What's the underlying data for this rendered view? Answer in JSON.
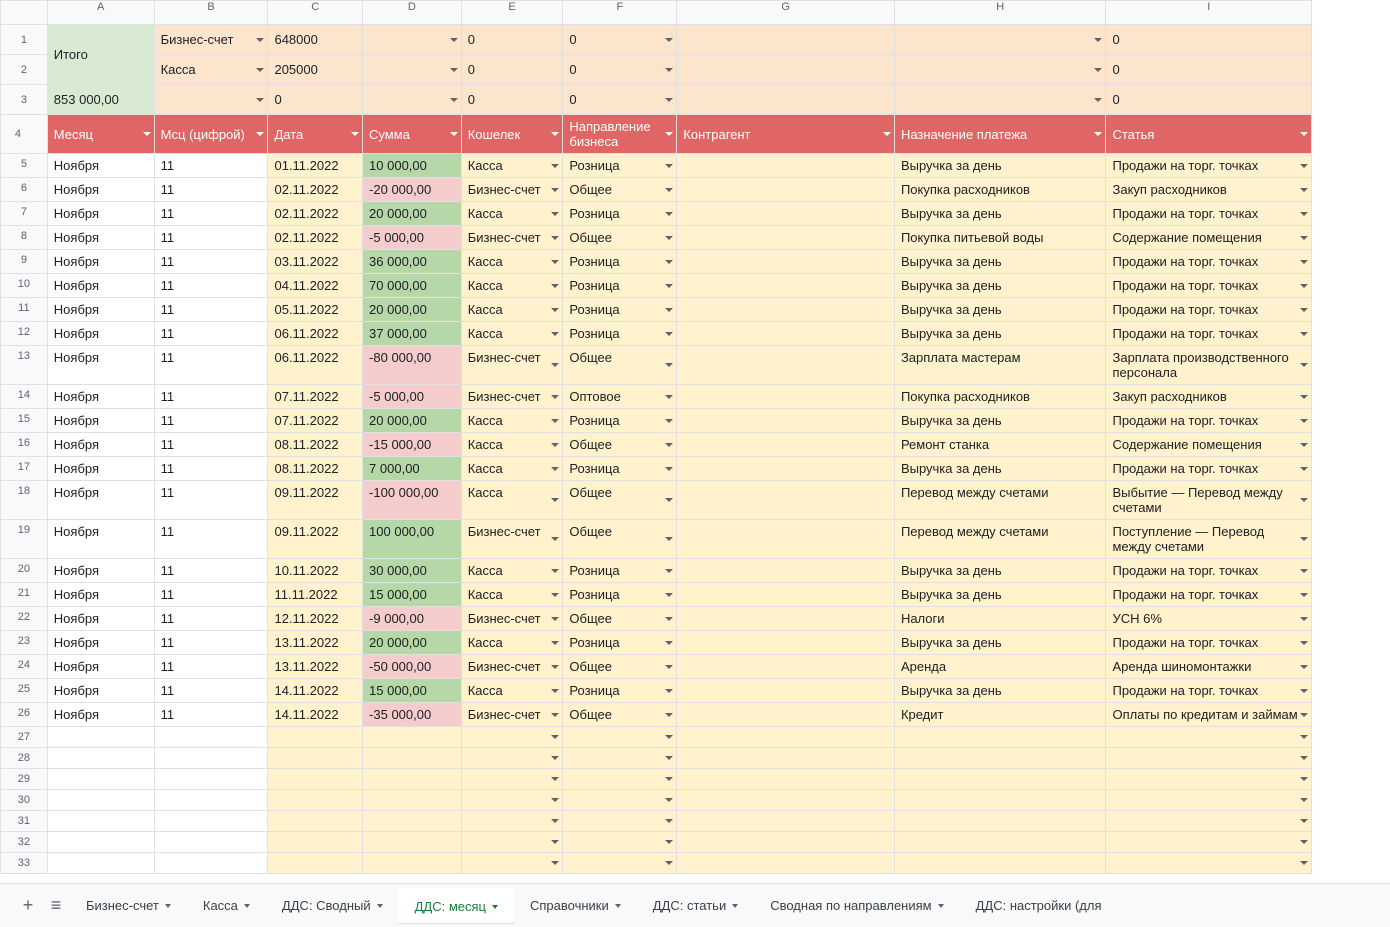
{
  "columns": [
    "A",
    "B",
    "C",
    "D",
    "E",
    "F",
    "G",
    "H",
    "I"
  ],
  "summary": {
    "itogo_label": "Итого",
    "row1": {
      "B": "Бизнес-счет",
      "C": "648000",
      "E": "0",
      "F": "0",
      "H": "",
      "I": "0"
    },
    "row2": {
      "B": "Касса",
      "C": "205000",
      "E": "0",
      "F": "0",
      "H": "",
      "I": "0"
    },
    "row3": {
      "A": "853 000,00",
      "B": "",
      "C": "0",
      "E": "0",
      "F": "0",
      "H": "",
      "I": "0"
    }
  },
  "headers": {
    "A": "Месяц",
    "B": "Мсц (цифрой)",
    "C": "Дата",
    "D": "Сумма",
    "E": "Кошелек",
    "F": "Направление бизнеса",
    "G": "Контрагент",
    "H": "Назначение платежа",
    "I": "Статья"
  },
  "rows": [
    {
      "n": "5",
      "A": "Ноября",
      "B": "11",
      "C": "01.11.2022",
      "D": "10 000,00",
      "Dcls": "bg-green",
      "E": "Касса",
      "F": "Розница",
      "G": "",
      "H": "Выручка за день",
      "I": "Продажи на торг. точках"
    },
    {
      "n": "6",
      "A": "Ноября",
      "B": "11",
      "C": "02.11.2022",
      "D": "-20 000,00",
      "Dcls": "bg-red",
      "E": "Бизнес-счет",
      "F": "Общее",
      "G": "",
      "H": "Покупка расходников",
      "I": "Закуп расходников"
    },
    {
      "n": "7",
      "A": "Ноября",
      "B": "11",
      "C": "02.11.2022",
      "D": "20 000,00",
      "Dcls": "bg-green",
      "E": "Касса",
      "F": "Розница",
      "G": "",
      "H": "Выручка за день",
      "I": "Продажи на торг. точках"
    },
    {
      "n": "8",
      "A": "Ноября",
      "B": "11",
      "C": "02.11.2022",
      "D": "-5 000,00",
      "Dcls": "bg-red",
      "E": "Бизнес-счет",
      "F": "Общее",
      "G": "",
      "H": "Покупка питьевой воды",
      "I": "Содержание помещения"
    },
    {
      "n": "9",
      "A": "Ноября",
      "B": "11",
      "C": "03.11.2022",
      "D": "36 000,00",
      "Dcls": "bg-green",
      "E": "Касса",
      "F": "Розница",
      "G": "",
      "H": "Выручка за день",
      "I": "Продажи на торг. точках"
    },
    {
      "n": "10",
      "A": "Ноября",
      "B": "11",
      "C": "04.11.2022",
      "D": "70 000,00",
      "Dcls": "bg-green",
      "E": "Касса",
      "F": "Розница",
      "G": "",
      "H": "Выручка за день",
      "I": "Продажи на торг. точках"
    },
    {
      "n": "11",
      "A": "Ноября",
      "B": "11",
      "C": "05.11.2022",
      "D": "20 000,00",
      "Dcls": "bg-green",
      "E": "Касса",
      "F": "Розница",
      "G": "",
      "H": "Выручка за день",
      "I": "Продажи на торг. точках"
    },
    {
      "n": "12",
      "A": "Ноября",
      "B": "11",
      "C": "06.11.2022",
      "D": "37 000,00",
      "Dcls": "bg-green",
      "E": "Касса",
      "F": "Розница",
      "G": "",
      "H": "Выручка за день",
      "I": "Продажи на торг. точках"
    },
    {
      "n": "13",
      "A": "Ноября",
      "B": "11",
      "C": "06.11.2022",
      "D": "-80 000,00",
      "Dcls": "bg-red",
      "E": "Бизнес-счет",
      "F": "Общее",
      "G": "",
      "H": "Зарплата мастерам",
      "I": "Зарплата производственного персонала",
      "Imulti": true
    },
    {
      "n": "14",
      "A": "Ноября",
      "B": "11",
      "C": "07.11.2022",
      "D": "-5 000,00",
      "Dcls": "bg-red",
      "E": "Бизнес-счет",
      "F": "Оптовое",
      "G": "",
      "H": "Покупка расходников",
      "I": "Закуп расходников"
    },
    {
      "n": "15",
      "A": "Ноября",
      "B": "11",
      "C": "07.11.2022",
      "D": "20 000,00",
      "Dcls": "bg-green",
      "E": "Касса",
      "F": "Розница",
      "G": "",
      "H": "Выручка за день",
      "I": "Продажи на торг. точках"
    },
    {
      "n": "16",
      "A": "Ноября",
      "B": "11",
      "C": "08.11.2022",
      "D": "-15 000,00",
      "Dcls": "bg-red",
      "E": "Касса",
      "F": "Общее",
      "G": "",
      "H": "Ремонт станка",
      "I": "Содержание помещения"
    },
    {
      "n": "17",
      "A": "Ноября",
      "B": "11",
      "C": "08.11.2022",
      "D": "7 000,00",
      "Dcls": "bg-green",
      "E": "Касса",
      "F": "Розница",
      "G": "",
      "H": "Выручка за день",
      "I": "Продажи на торг. точках"
    },
    {
      "n": "18",
      "A": "Ноября",
      "B": "11",
      "C": "09.11.2022",
      "D": "-100 000,00",
      "Dcls": "bg-red",
      "E": "Касса",
      "F": "Общее",
      "G": "",
      "H": "Перевод между счетами",
      "I": "Выбытие — Перевод между счетами",
      "Imulti": true
    },
    {
      "n": "19",
      "A": "Ноября",
      "B": "11",
      "C": "09.11.2022",
      "D": "100 000,00",
      "Dcls": "bg-green",
      "E": "Бизнес-счет",
      "F": "Общее",
      "G": "",
      "H": "Перевод между счетами",
      "I": "Поступление — Перевод между счетами",
      "Imulti": true
    },
    {
      "n": "20",
      "A": "Ноября",
      "B": "11",
      "C": "10.11.2022",
      "D": "30 000,00",
      "Dcls": "bg-green",
      "E": "Касса",
      "F": "Розница",
      "G": "",
      "H": "Выручка за день",
      "I": "Продажи на торг. точках"
    },
    {
      "n": "21",
      "A": "Ноября",
      "B": "11",
      "C": "11.11.2022",
      "D": "15 000,00",
      "Dcls": "bg-green",
      "E": "Касса",
      "F": "Розница",
      "G": "",
      "H": "Выручка за день",
      "I": "Продажи на торг. точках"
    },
    {
      "n": "22",
      "A": "Ноября",
      "B": "11",
      "C": "12.11.2022",
      "D": "-9 000,00",
      "Dcls": "bg-red",
      "E": "Бизнес-счет",
      "F": "Общее",
      "G": "",
      "H": "Налоги",
      "I": "УСН 6%"
    },
    {
      "n": "23",
      "A": "Ноября",
      "B": "11",
      "C": "13.11.2022",
      "D": "20 000,00",
      "Dcls": "bg-green",
      "E": "Касса",
      "F": "Розница",
      "G": "",
      "H": "Выручка за день",
      "I": "Продажи на торг. точках"
    },
    {
      "n": "24",
      "A": "Ноября",
      "B": "11",
      "C": "13.11.2022",
      "D": "-50 000,00",
      "Dcls": "bg-red",
      "E": "Бизнес-счет",
      "F": "Общее",
      "G": "",
      "H": "Аренда",
      "I": "Аренда шиномонтажки"
    },
    {
      "n": "25",
      "A": "Ноября",
      "B": "11",
      "C": "14.11.2022",
      "D": "15 000,00",
      "Dcls": "bg-green",
      "E": "Касса",
      "F": "Розница",
      "G": "",
      "H": "Выручка за день",
      "I": "Продажи на торг. точках"
    },
    {
      "n": "26",
      "A": "Ноября",
      "B": "11",
      "C": "14.11.2022",
      "D": "-35 000,00",
      "Dcls": "bg-red",
      "E": "Бизнес-счет",
      "F": "Общее",
      "G": "",
      "H": "Кредит",
      "I": "Оплаты по кредитам и займам",
      "Imulti": true
    }
  ],
  "empty_rows": [
    "27",
    "28",
    "29",
    "30",
    "31",
    "32",
    "33"
  ],
  "tabs": [
    {
      "label": "Бизнес-счет",
      "active": false
    },
    {
      "label": "Касса",
      "active": false
    },
    {
      "label": "ДДС: Сводный",
      "active": false
    },
    {
      "label": "ДДС: месяц",
      "active": true
    },
    {
      "label": "Справочники",
      "active": false
    },
    {
      "label": "ДДС: статьи",
      "active": false
    },
    {
      "label": "Сводная по направлениям",
      "active": false
    },
    {
      "label": "ДДС: настройки (для",
      "active": false,
      "nodd": true
    }
  ]
}
